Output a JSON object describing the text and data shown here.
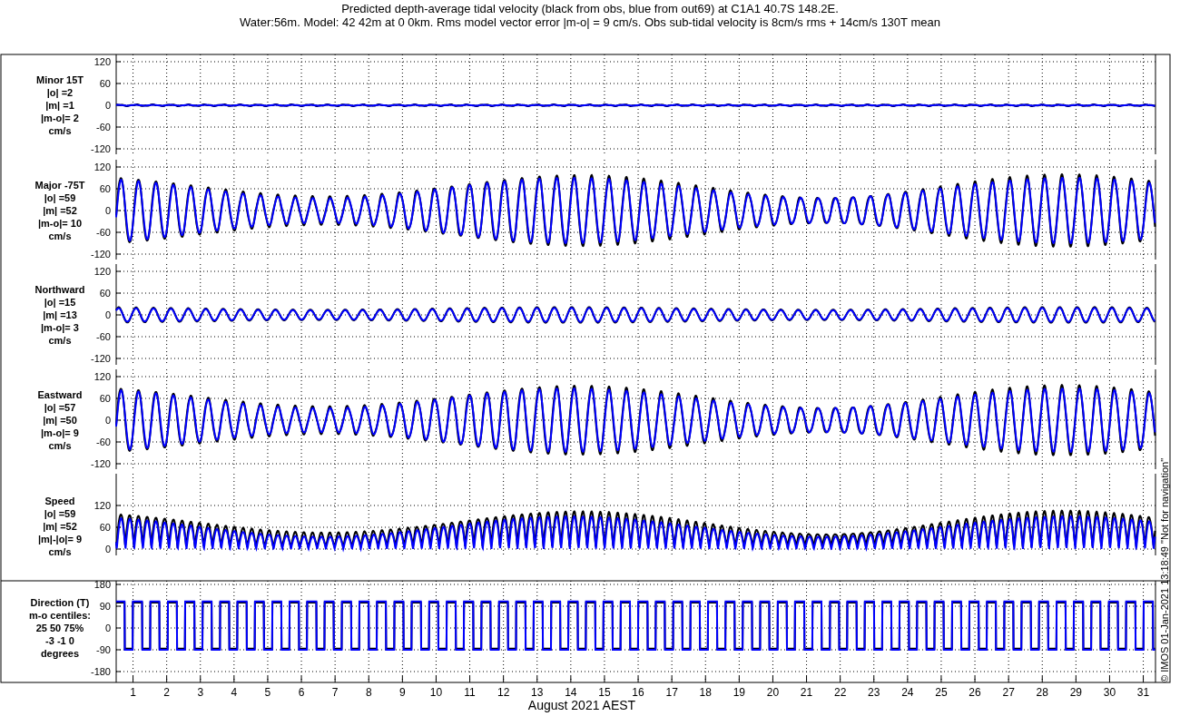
{
  "title": [
    "Predicted depth-average tidal velocity (black from obs, blue from out69) at C1A1 40.7S 148.2E.",
    "Water:56m. Model: 42 42m at 0 0km. Rms model vector error |m-o| = 9 cm/s. Obs sub-tidal velocity is 8cm/s rms + 14cm/s 130T mean"
  ],
  "panels": [
    {
      "kind": "minor",
      "label": [
        "Minor 15T",
        "|o| =2",
        "|m| =1",
        "|m-o|= 2",
        "cm/s"
      ],
      "yticks": [
        "120",
        "60",
        "0",
        "-60",
        "-120"
      ]
    },
    {
      "kind": "major",
      "label": [
        "Major -75T",
        "|o| =59",
        "|m| =52",
        "|m-o|= 10",
        "cm/s"
      ],
      "yticks": [
        "120",
        "60",
        "0",
        "-60",
        "-120"
      ]
    },
    {
      "kind": "north",
      "label": [
        "Northward",
        "|o| =15",
        "|m| =13",
        "|m-o|= 3",
        "cm/s"
      ],
      "yticks": [
        "120",
        "60",
        "0",
        "-60",
        "-120"
      ]
    },
    {
      "kind": "east",
      "label": [
        "Eastward",
        "|o| =57",
        "|m| =50",
        "|m-o|= 9",
        "cm/s"
      ],
      "yticks": [
        "120",
        "60",
        "0",
        "-60",
        "-120"
      ]
    },
    {
      "kind": "speed",
      "label": [
        "Speed",
        "|o| =59",
        "|m| =52",
        "|m|-|o|= 9",
        "cm/s"
      ],
      "yticks": [
        "120",
        "60",
        "0"
      ]
    },
    {
      "kind": "direction",
      "label": [
        "Direction (T)",
        "m-o centiles:",
        "25  50  75%",
        "-3 -1  0",
        "degrees"
      ],
      "yticks": [
        "180",
        "90",
        "0",
        "-90",
        "-180"
      ]
    }
  ],
  "x_axis": {
    "ticks": [
      "1",
      "2",
      "3",
      "4",
      "5",
      "6",
      "7",
      "8",
      "9",
      "10",
      "11",
      "12",
      "13",
      "14",
      "15",
      "16",
      "17",
      "18",
      "19",
      "20",
      "21",
      "22",
      "23",
      "24",
      "25",
      "26",
      "27",
      "28",
      "29",
      "30",
      "31"
    ],
    "label": "August 2021 AEST"
  },
  "credit": "© IMOS 01-Jan-2021 13:18:49  \"Not for navigation\""
}
